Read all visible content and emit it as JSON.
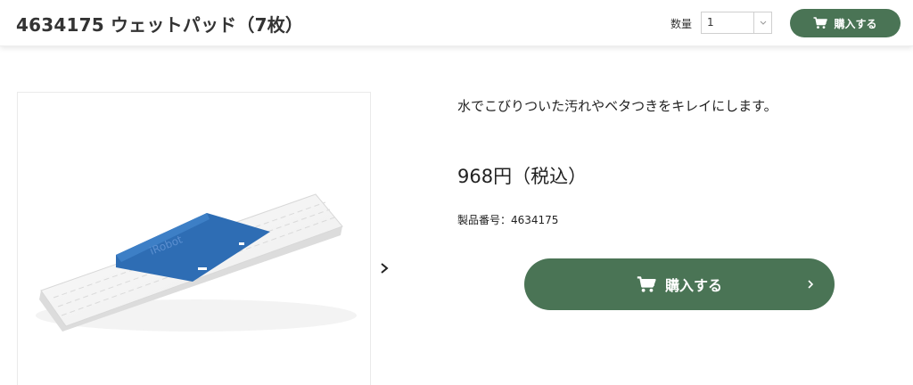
{
  "header": {
    "title": "4634175 ウェットパッド（7枚）",
    "quantity_label": "数量",
    "quantity_value": "1",
    "buy_label": "購入する"
  },
  "product": {
    "description": "水でこびりついた汚れやベタつきをキレイにします。",
    "price": "968円（税込）",
    "product_number": "製品番号：4634175",
    "image_logo_text": "iRobot",
    "buy_label": "購入する"
  },
  "icons": {
    "cart": "cart-icon",
    "next": "chevron-right-icon",
    "dropdown": "chevron-down-icon"
  },
  "colors": {
    "accent": "#4a7455",
    "pad_blue": "#2e6db4"
  }
}
